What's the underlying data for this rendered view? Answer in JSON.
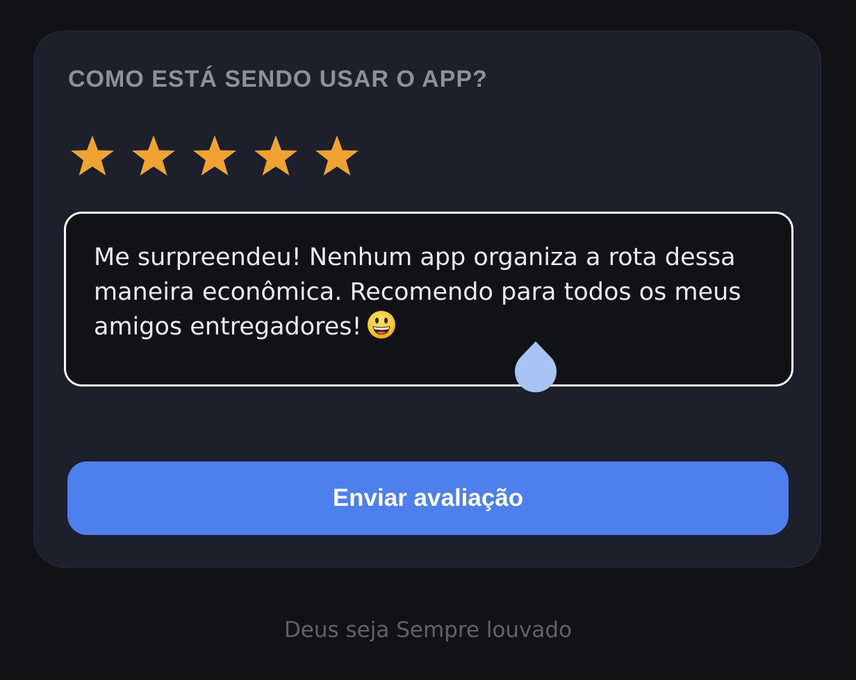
{
  "rating_card": {
    "question": "COMO ESTÁ SENDO USAR O APP?",
    "rating": {
      "value": 5,
      "max": 5,
      "star_color": "#f0a233"
    },
    "review": {
      "text": "Me surpreendeu! Nenhum app organiza a rota dessa maneira econômica. Recomendo para todos os meus amigos entregadores!",
      "emoji": "grinning-face-emoji"
    },
    "submit_label": "Enviar avaliação",
    "accent_color": "#4d80ec"
  },
  "footer": {
    "text": "Deus seja Sempre louvado"
  }
}
